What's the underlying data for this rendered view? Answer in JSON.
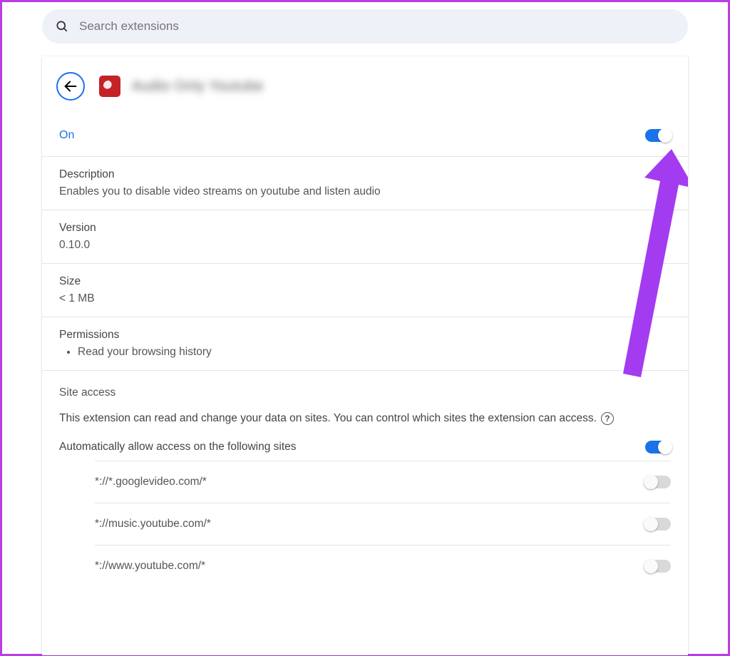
{
  "search": {
    "placeholder": "Search extensions"
  },
  "header": {
    "extension_name": "Audio Only Youtube"
  },
  "status": {
    "on_label": "On",
    "enabled": true
  },
  "description": {
    "label": "Description",
    "value": "Enables you to disable video streams on youtube and listen audio"
  },
  "version": {
    "label": "Version",
    "value": "0.10.0"
  },
  "size": {
    "label": "Size",
    "value": "< 1 MB"
  },
  "permissions": {
    "label": "Permissions",
    "items": [
      "Read your browsing history"
    ]
  },
  "site_access": {
    "title": "Site access",
    "desc": "This extension can read and change your data on sites. You can control which sites the extension can access.",
    "auto_label": "Automatically allow access on the following sites",
    "auto_on": true,
    "sites": [
      {
        "pattern": "*://*.googlevideo.com/*",
        "on": false
      },
      {
        "pattern": "*://music.youtube.com/*",
        "on": false
      },
      {
        "pattern": "*://www.youtube.com/*",
        "on": false
      }
    ]
  }
}
